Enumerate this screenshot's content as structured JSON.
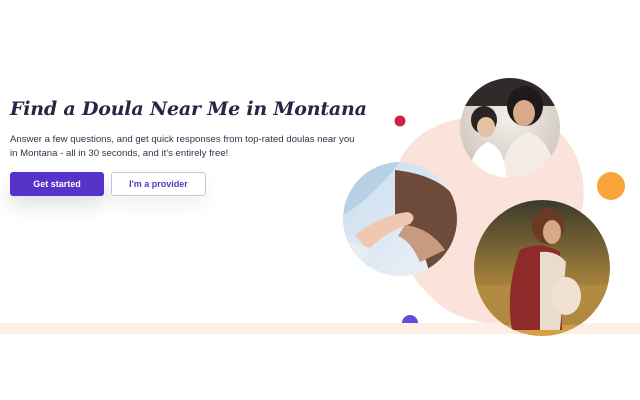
{
  "hero": {
    "title": "Find a Doula Near Me in Montana",
    "subtitle": "Answer a few questions, and get quick responses from top-rated doulas near you in Montana - all in 30 seconds, and it's entirely free!",
    "primary_button": "Get started",
    "secondary_button": "I'm a provider"
  },
  "colors": {
    "brand_purple": "#5634c9",
    "accent_orange": "#f7a53a",
    "accent_red": "#c8234a",
    "blush": "#fbe3dc"
  },
  "images": [
    "mother-and-child-photo",
    "baby-hand-holding-finger-photo",
    "pregnant-woman-photo"
  ]
}
